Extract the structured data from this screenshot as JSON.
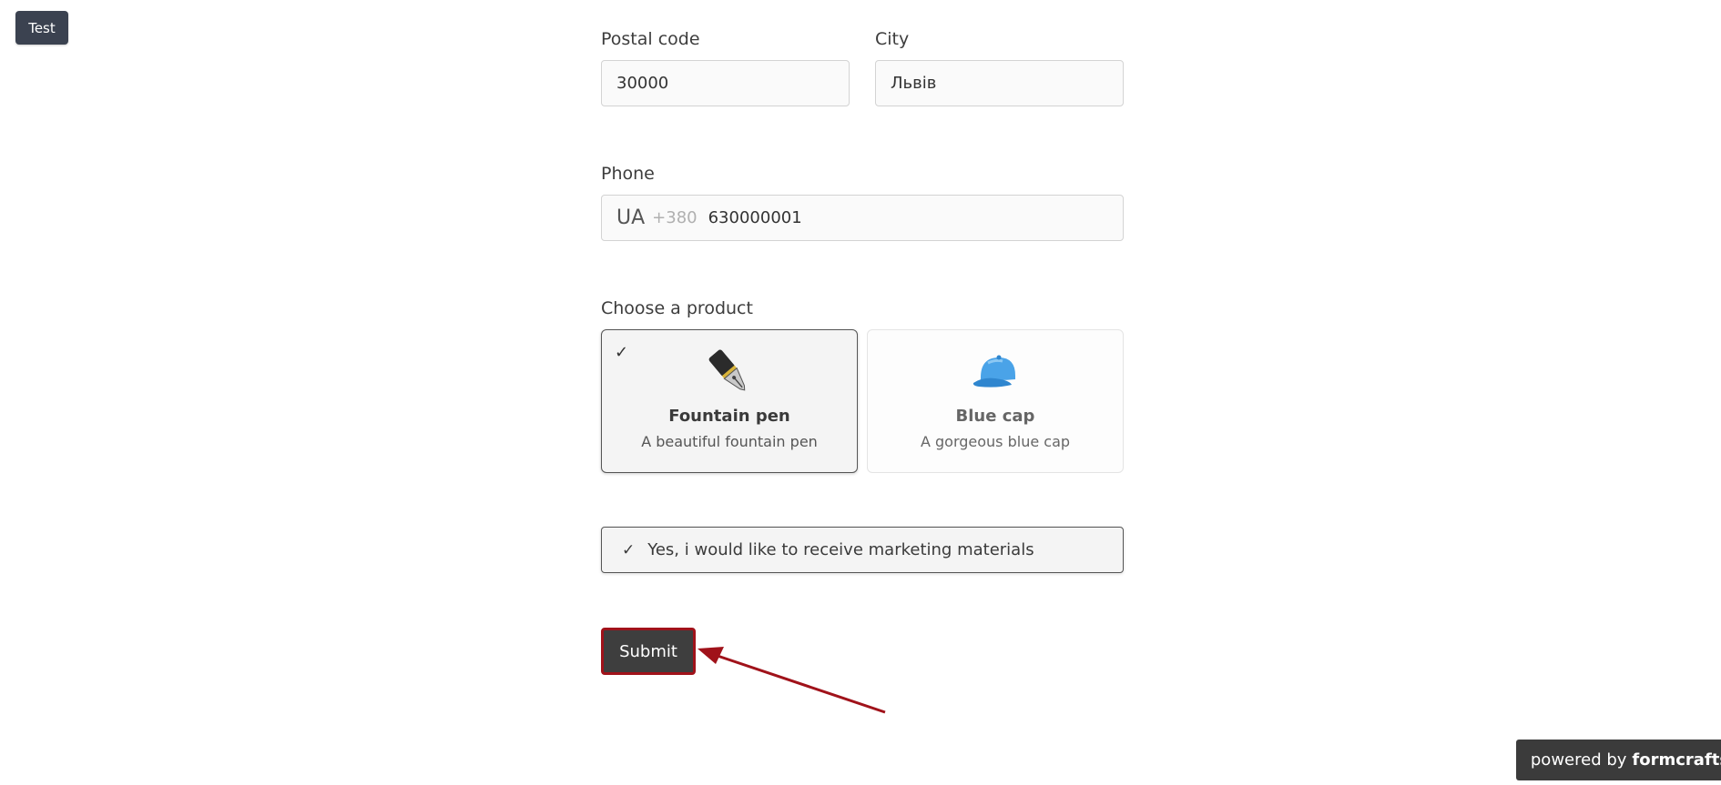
{
  "test_button": "Test",
  "postal": {
    "label": "Postal code",
    "value": "30000"
  },
  "city": {
    "label": "City",
    "value": "Львів"
  },
  "phone": {
    "label": "Phone",
    "country": "UA",
    "dial_code": "+380",
    "value": "630000001"
  },
  "product": {
    "label": "Choose a product",
    "options": [
      {
        "title": "Fountain pen",
        "description": "A beautiful fountain pen",
        "icon": "fountain-pen-icon",
        "selected": true
      },
      {
        "title": "Blue cap",
        "description": "A gorgeous blue cap",
        "icon": "blue-cap-icon",
        "selected": false
      }
    ]
  },
  "consent": {
    "label": "Yes, i would like to receive marketing materials",
    "checked": true
  },
  "submit_label": "Submit",
  "powered_by": {
    "prefix": "powered by",
    "brand": "formcrafts"
  },
  "colors": {
    "accent": "#3e3e3e",
    "highlight": "#a0121a",
    "test_button": "#3b4250"
  }
}
